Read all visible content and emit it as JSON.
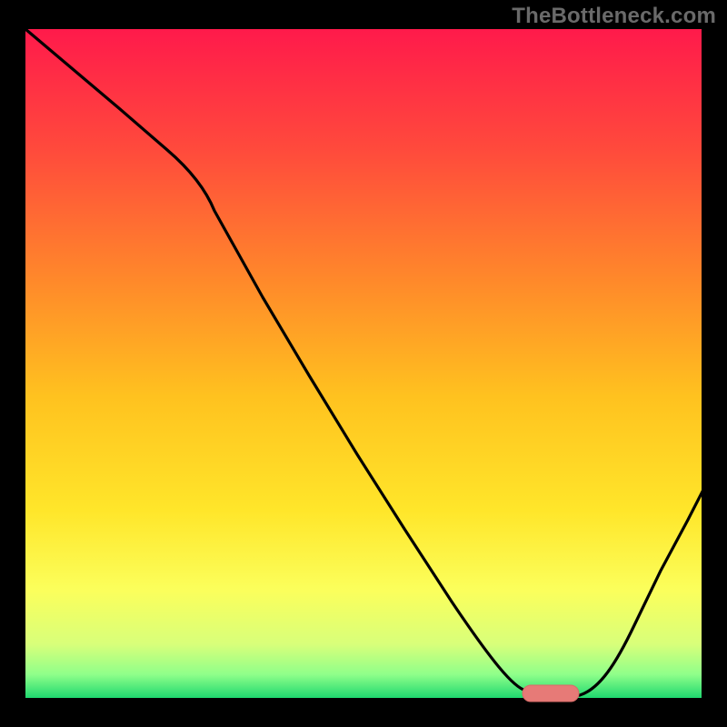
{
  "watermark": "TheBottleneck.com",
  "chart_data": {
    "type": "line",
    "title": "",
    "xlabel": "",
    "ylabel": "",
    "xlim": [
      0,
      100
    ],
    "ylim": [
      0,
      100
    ],
    "grid": false,
    "legend": false,
    "annotations": [
      {
        "watermark": "TheBottleneck.com",
        "position": "top-right"
      }
    ],
    "background_gradient": {
      "stops": [
        {
          "t": 0.0,
          "color": "#ff1a4b"
        },
        {
          "t": 0.18,
          "color": "#ff4a3c"
        },
        {
          "t": 0.38,
          "color": "#ff8a2a"
        },
        {
          "t": 0.55,
          "color": "#ffc21f"
        },
        {
          "t": 0.72,
          "color": "#ffe62a"
        },
        {
          "t": 0.84,
          "color": "#fbff5c"
        },
        {
          "t": 0.92,
          "color": "#d8ff7a"
        },
        {
          "t": 0.965,
          "color": "#8fff8a"
        },
        {
          "t": 1.0,
          "color": "#1fd86f"
        }
      ]
    },
    "optimum_marker": {
      "x_range": [
        74,
        82
      ],
      "y": 0,
      "color": "#e77a77"
    },
    "series": [
      {
        "name": "bottleneck-curve",
        "color": "#000000",
        "x": [
          0,
          7,
          14,
          21,
          28,
          35,
          42,
          49,
          56,
          63,
          70,
          74,
          78,
          82,
          86,
          90,
          94,
          100
        ],
        "y": [
          100,
          94,
          88,
          82,
          76,
          66,
          55,
          44,
          33,
          22,
          11,
          2,
          0,
          0,
          9,
          18,
          26,
          38
        ]
      }
    ]
  }
}
